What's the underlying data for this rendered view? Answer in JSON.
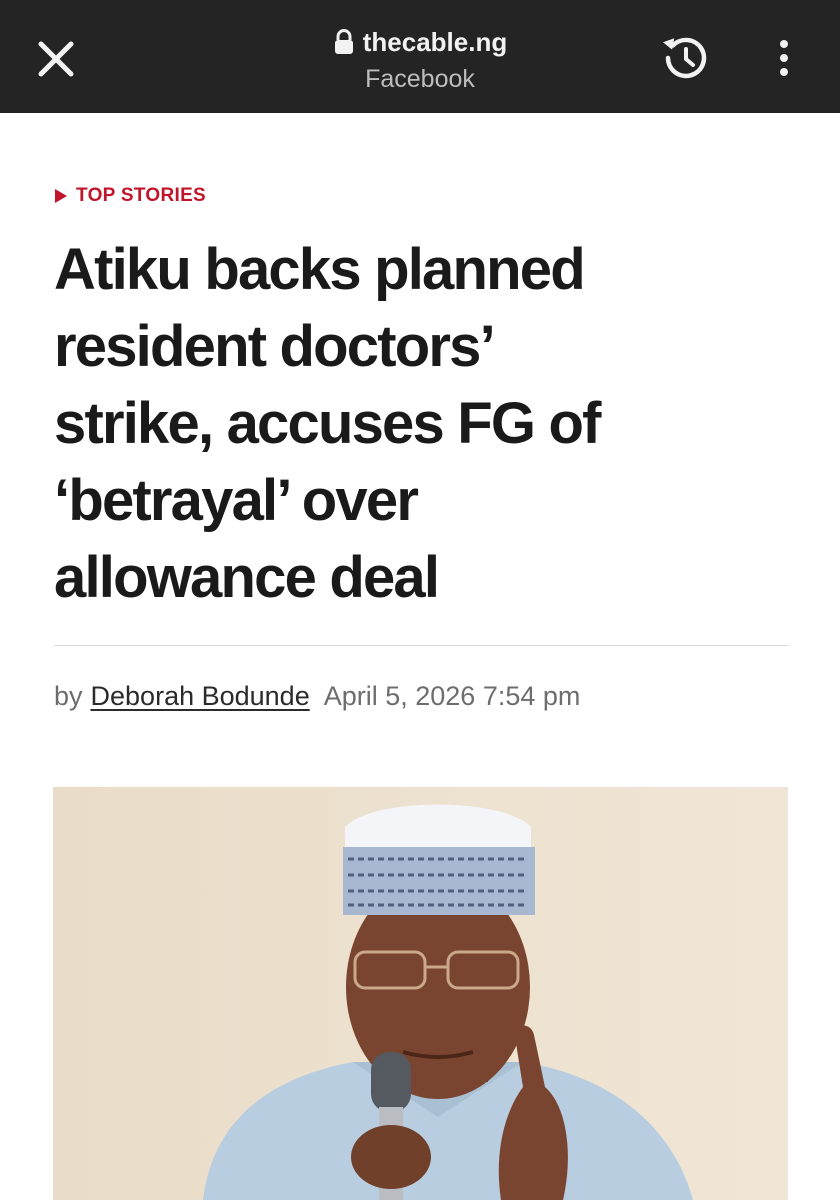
{
  "browser": {
    "url": "thecable.ng",
    "source": "Facebook",
    "icons": {
      "close": "close-icon",
      "lock": "lock-icon",
      "history": "history-icon",
      "menu": "more-vertical-icon"
    }
  },
  "article": {
    "category": "TOP STORIES",
    "headline_lines": [
      "Atiku backs planned",
      "resident doctors’",
      "strike, accuses FG of",
      "‘betrayal’ over",
      "allowance deal"
    ],
    "byline_prefix": "by",
    "author": "Deborah Bodunde",
    "date": "April 5, 2026 7:54 pm"
  },
  "colors": {
    "topbar": "#242424",
    "category": "#c0152a",
    "headline": "#1a1a1a"
  }
}
